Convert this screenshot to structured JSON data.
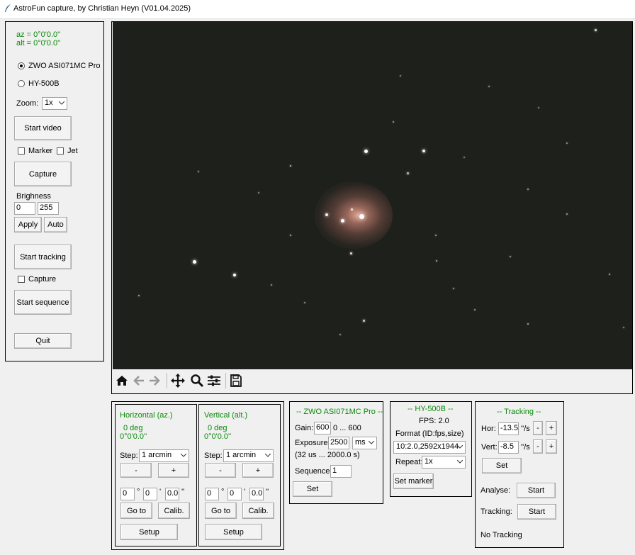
{
  "window": {
    "title": "AstroFun capture, by Christian Heyn (V01.04.2025)"
  },
  "left": {
    "az": "az  = 0°0'0.0''",
    "alt": "alt = 0°0'0.0''",
    "camera_options": [
      "ZWO ASI071MC Pro",
      "HY-500B"
    ],
    "selected_camera": "ZWO ASI071MC Pro",
    "zoom_label": "Zoom:",
    "zoom_value": "1x",
    "start_video": "Start video",
    "marker_label": "Marker",
    "jet_label": "Jet",
    "capture_button": "Capture",
    "brightness_label": "Brighness",
    "brightness_min": "0",
    "brightness_max": "255",
    "apply": "Apply",
    "auto": "Auto",
    "start_tracking": "Start tracking",
    "capture_check_label": "Capture",
    "start_sequence": "Start sequence",
    "quit": "Quit"
  },
  "horizontal": {
    "title": "Horizontal (az.)",
    "deg": "0 deg",
    "dms": "0°0'0.0''",
    "step_label": "Step:",
    "step_value": "1 arcmin",
    "minus": "-",
    "plus": "+",
    "d": "0",
    "m": "0",
    "s": "0.0",
    "deg_sym": "°",
    "min_sym": "'",
    "sec_sym": "''",
    "goto": "Go to",
    "calib": "Calib.",
    "setup": "Setup"
  },
  "vertical": {
    "title": "Vertical  (alt.)",
    "deg": "0 deg",
    "dms": "0°0'0.0''",
    "step_label": "Step:",
    "step_value": "1 arcmin",
    "minus": "-",
    "plus": "+",
    "d": "0",
    "m": "0",
    "s": "0.0",
    "deg_sym": "°",
    "min_sym": "'",
    "sec_sym": "''",
    "goto": "Go to",
    "calib": "Calib.",
    "setup": "Setup"
  },
  "zwo": {
    "title": "--  ZWO ASI071MC Pro  --",
    "gain_label": "Gain:",
    "gain_value": "600",
    "gain_range": "0 ... 600",
    "exposure_label": "Exposure:",
    "exposure_value": "2500",
    "exposure_unit": "ms",
    "exposure_range": "(32 us ... 2000.0 s)",
    "sequence_label": "Sequence:",
    "sequence_value": "1",
    "set": "Set"
  },
  "hy": {
    "title": "--  HY-500B  --",
    "fps": "FPS: 2.0",
    "format_label": "Format (ID:fps,size)",
    "format_value": "10:2.0,2592x1944",
    "repeat_label": "Repeat:",
    "repeat_value": "1x",
    "set_marker": "Set marker"
  },
  "tracking": {
    "title": "--  Tracking  --",
    "hor_label": "Hor:",
    "hor_value": "-13.5",
    "vert_label": "Vert:",
    "vert_value": "-8.5",
    "unit": "''/s",
    "minus": "-",
    "plus": "+",
    "set": "Set",
    "analyse_label": "Analyse:",
    "tracking_label": "Tracking:",
    "start": "Start",
    "status": "No Tracking"
  },
  "toolbar": {
    "icons": [
      "home-icon",
      "back-arrow-icon",
      "forward-arrow-icon",
      "pan-icon",
      "zoom-icon",
      "configure-subplots-icon",
      "save-icon"
    ]
  }
}
